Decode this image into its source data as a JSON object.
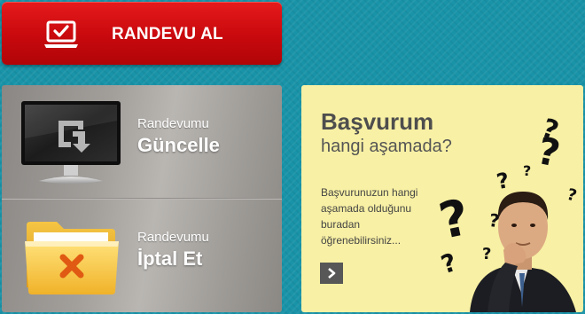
{
  "appointment_button": {
    "label": "RANDEVU AL",
    "icon": "laptop-check-icon"
  },
  "actions": [
    {
      "small_label": "Randevumu",
      "big_label": "Güncelle",
      "icon": "monitor-refresh-icon"
    },
    {
      "small_label": "Randevumu",
      "big_label": "İptal Et",
      "icon": "folder-cancel-icon"
    }
  ],
  "status_card": {
    "title": "Başvurum",
    "subtitle": "hangi aşamada?",
    "description_lines": [
      "Başvurunuzun hangi",
      "aşamada olduğunu",
      "buradan",
      "öğrenebilirsiniz..."
    ],
    "arrow_icon": "chevron-right-icon",
    "image": "thinking-man-with-question-marks"
  },
  "colors": {
    "background": "#1993a8",
    "button_red": "#d0100f",
    "panel_grey": "#a29f9b",
    "card_yellow": "#f8f0a4",
    "arrow_button": "#575757"
  }
}
